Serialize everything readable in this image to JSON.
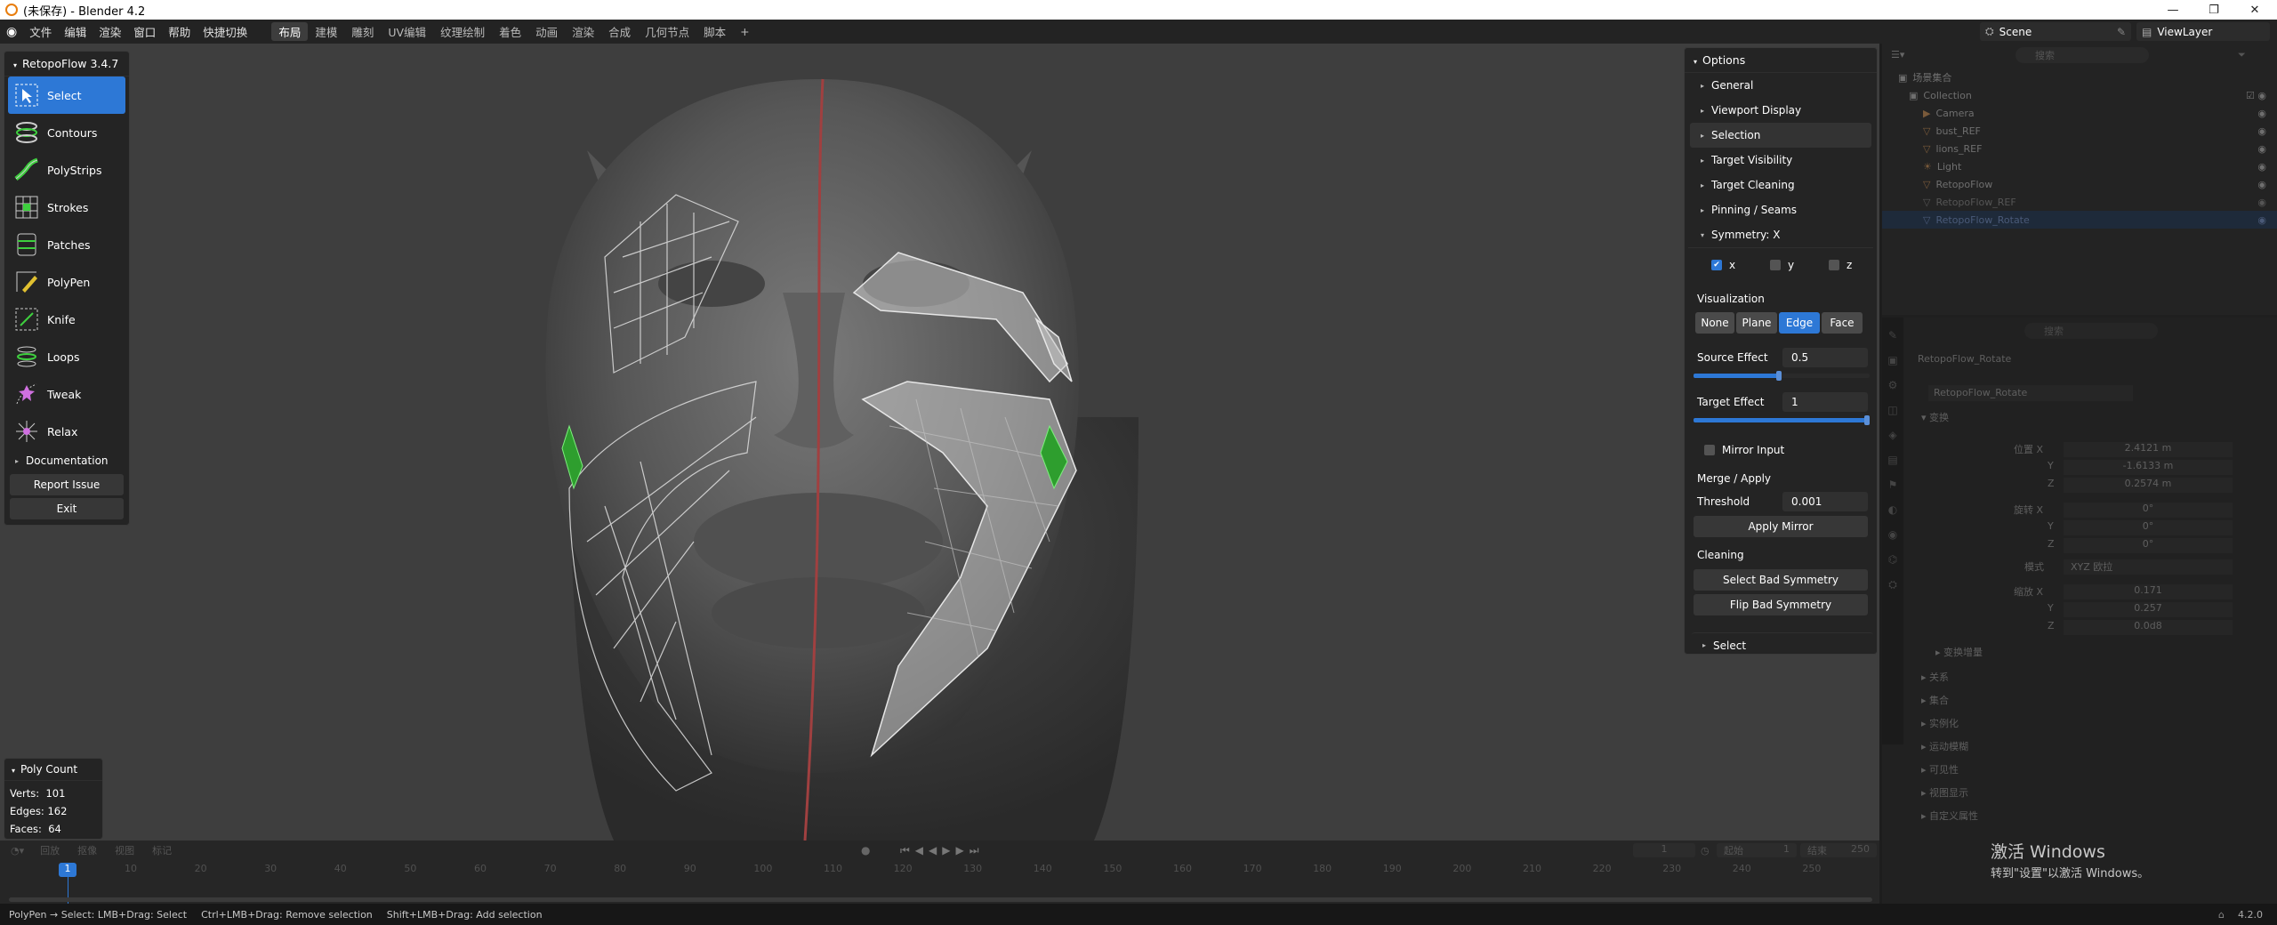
{
  "window": {
    "title": "(未保存) - Blender 4.2"
  },
  "menu": [
    "文件",
    "编辑",
    "渲染",
    "窗口",
    "帮助",
    "快捷切换"
  ],
  "workspaces": [
    "布局",
    "建模",
    "雕刻",
    "UV编辑",
    "纹理绘制",
    "着色",
    "动画",
    "渲染",
    "合成",
    "几何节点",
    "脚本"
  ],
  "add_tab": "+",
  "scene": {
    "label": "Scene",
    "viewlayer": "ViewLayer"
  },
  "retopo": {
    "title": "RetopoFlow 3.4.7",
    "tools": [
      "Select",
      "Contours",
      "PolyStrips",
      "Strokes",
      "Patches",
      "PolyPen",
      "Knife",
      "Loops",
      "Tweak",
      "Relax"
    ],
    "documentation": "Documentation",
    "report": "Report Issue",
    "exit": "Exit"
  },
  "polycount": {
    "title": "Poly Count",
    "verts_label": "Verts:",
    "verts": "101",
    "edges_label": "Edges:",
    "edges": "162",
    "faces_label": "Faces:",
    "faces": "64"
  },
  "options": {
    "title": "Options",
    "sections": [
      "General",
      "Viewport Display",
      "Selection",
      "Target Visibility",
      "Target Cleaning",
      "Pinning / Seams"
    ],
    "symmetry": "Symmetry: X",
    "axes": [
      "x",
      "y",
      "z"
    ],
    "visualization": "Visualization",
    "vis_modes": [
      "None",
      "Plane",
      "Edge",
      "Face"
    ],
    "source_effect_label": "Source Effect",
    "source_effect": "0.5",
    "target_effect_label": "Target Effect",
    "target_effect": "1",
    "source_fill": 0.5,
    "target_fill": 1.0,
    "mirror_input": "Mirror Input",
    "merge_apply": "Merge / Apply",
    "threshold_label": "Threshold",
    "threshold": "0.001",
    "apply_mirror": "Apply Mirror",
    "cleaning": "Cleaning",
    "select_bad": "Select Bad Symmetry",
    "flip_bad": "Flip Bad Symmetry",
    "select_section": "Select"
  },
  "outliner": {
    "search": "搜索",
    "scene_collection": "场景集合",
    "items": [
      "Collection",
      "Camera",
      "bust_REF",
      "lions_REF",
      "Light",
      "RetopoFlow",
      "RetopoFlow_REF",
      "RetopoFlow_Rotate"
    ]
  },
  "properties": {
    "search": "搜索",
    "object": "RetopoFlow_Rotate",
    "transform": "变换",
    "loc_label": "位置 X",
    "loc": [
      "2.4121 m",
      "-1.6133 m",
      "0.2574 m"
    ],
    "rot_label": "旋转 X",
    "rot": [
      "0°",
      "0°",
      "0°"
    ],
    "mode_label": "模式",
    "mode": "XYZ 欧拉",
    "scale_label": "缩放 X",
    "scale": [
      "0.171",
      "0.257",
      "0.0d8"
    ],
    "yz": [
      "Y",
      "Z"
    ],
    "sections": [
      "变换增量",
      "关系",
      "集合",
      "实例化",
      "运动模糊",
      "可见性",
      "视图显示",
      "自定义属性"
    ]
  },
  "timeline": {
    "menus": [
      "回放",
      "抠像",
      "视图",
      "标记"
    ],
    "current_frame": "1",
    "frame_display": "1",
    "start_label": "起始",
    "start": "1",
    "end_label": "结束",
    "end": "250",
    "ticks": [
      "10",
      "20",
      "30",
      "40",
      "50",
      "60",
      "70",
      "80",
      "90",
      "100",
      "110",
      "120",
      "130",
      "140",
      "150",
      "160",
      "170",
      "180",
      "190",
      "200",
      "210",
      "220",
      "230",
      "240",
      "250"
    ]
  },
  "watermark": {
    "title": "激活 Windows",
    "sub": "转到\"设置\"以激活 Windows。"
  },
  "status": {
    "left": "PolyPen → Select: LMB+Drag: Select",
    "mid": "Ctrl+LMB+Drag: Remove selection",
    "right": "Shift+LMB+Drag: Add selection",
    "version": "4.2.0"
  }
}
